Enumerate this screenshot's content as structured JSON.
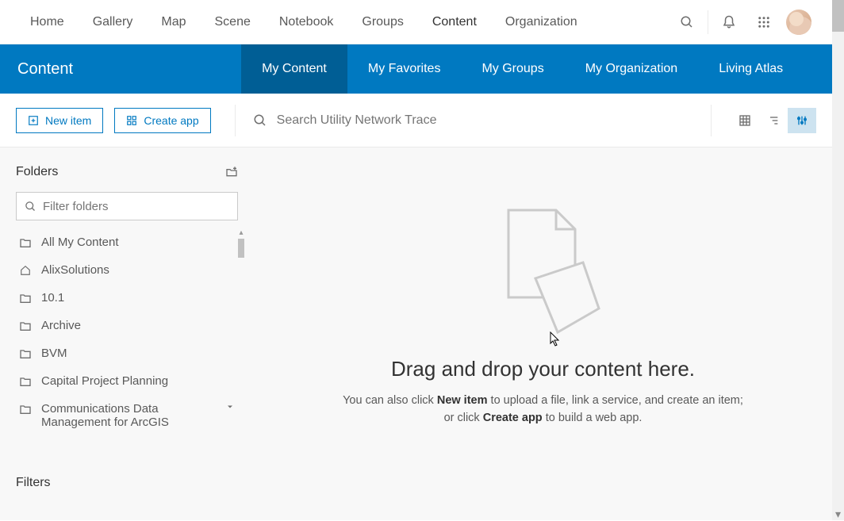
{
  "topnav": {
    "items": [
      "Home",
      "Gallery",
      "Map",
      "Scene",
      "Notebook",
      "Groups",
      "Content",
      "Organization"
    ],
    "active_index": 6
  },
  "bluebar": {
    "title": "Content",
    "tabs": [
      "My Content",
      "My Favorites",
      "My Groups",
      "My Organization",
      "Living Atlas"
    ],
    "active_index": 0
  },
  "toolbar": {
    "new_item_label": "New item",
    "create_app_label": "Create app",
    "search_placeholder": "Search Utility Network Trace"
  },
  "sidebar": {
    "folders_header": "Folders",
    "filter_placeholder": "Filter folders",
    "folders": [
      {
        "label": "All My Content",
        "icon": "folder"
      },
      {
        "label": "AlixSolutions",
        "icon": "home"
      },
      {
        "label": "10.1",
        "icon": "folder"
      },
      {
        "label": "Archive",
        "icon": "folder"
      },
      {
        "label": "BVM",
        "icon": "folder"
      },
      {
        "label": "Capital Project Planning",
        "icon": "folder"
      },
      {
        "label": "Communications Data Management for ArcGIS",
        "icon": "folder",
        "has_chevron": true
      }
    ],
    "filters_header": "Filters"
  },
  "empty": {
    "title": "Drag and drop your content here.",
    "sub_prefix": "You can also click ",
    "sub_bold1": "New item",
    "sub_mid": " to upload a file, link a service, and create an item; or click ",
    "sub_bold2": "Create app",
    "sub_suffix": " to build a web app."
  }
}
